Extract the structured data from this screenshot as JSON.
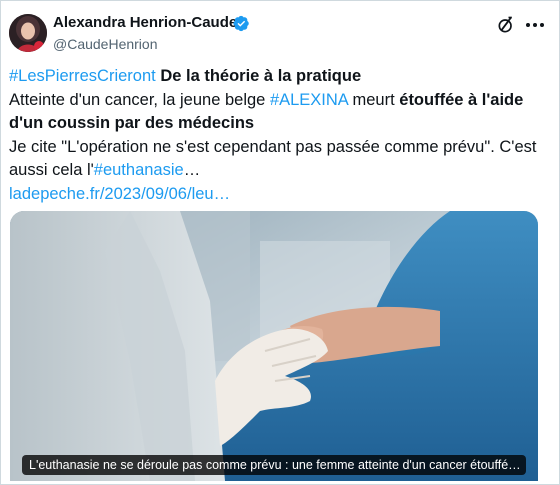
{
  "author": {
    "name": "Alexandra Henrion-Caude",
    "handle": "@CaudeHenrion",
    "avatar": "avatar"
  },
  "icons": {
    "verified": "verified-badge-icon",
    "brand": "x-logo-icon",
    "more": "more-options-icon"
  },
  "tweet": {
    "hashtag1": "#LesPierresCrieront",
    "title_bold": " De la théorie à la pratique",
    "line2_pre": "Atteinte d'un cancer, la jeune belge ",
    "hashtag2": "#ALEXINA",
    "line2_mid": " meurt ",
    "line2_bold": "étouffée à l'aide",
    "line3_bold": "d'un coussin par des médecins",
    "line4": "Je cite \"L'opération ne s'est cependant pas passée comme prévu\". C'est",
    "line5_pre": "aussi cela l'",
    "hashtag3": "#euthanasie",
    "line5_post": "…",
    "link": "ladepeche.fr/2023/09/06/leu…"
  },
  "media": {
    "caption": "L'euthanasie ne se déroule pas comme prévu : une femme atteinte d'un cancer étouffé…"
  },
  "colors": {
    "accent": "#1d9bf0",
    "text": "#0f1419",
    "secondary": "#536471",
    "border": "#cfd9de"
  }
}
